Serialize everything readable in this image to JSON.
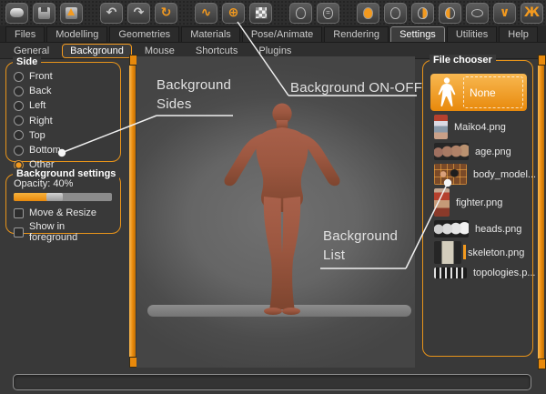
{
  "window": {
    "bg": "#393939"
  },
  "colors": {
    "accent": "#f39a1f",
    "accent_dark": "#e8890b",
    "skin": "#9c5740",
    "viewport_bg": "#656565"
  },
  "toolbar": {
    "items": [
      {
        "name": "new-mesh",
        "icon": "new-document-icon",
        "glyph_type": "shape",
        "shape": "roundrect"
      },
      {
        "name": "save",
        "icon": "floppy-save-icon",
        "glyph_type": "shape",
        "shape": "floppy"
      },
      {
        "name": "load",
        "icon": "floppy-load-icon",
        "glyph_type": "shape",
        "shape": "floppy-up"
      },
      {
        "sep": true
      },
      {
        "name": "undo",
        "icon": "undo-arrow-icon",
        "glyph_type": "char",
        "char": "↶",
        "tone": "gray"
      },
      {
        "name": "redo",
        "icon": "redo-arrow-icon",
        "glyph_type": "char",
        "char": "↷",
        "tone": "gray"
      },
      {
        "name": "reset",
        "icon": "reset-circular-arrow-icon",
        "glyph_type": "char",
        "char": "↻",
        "tone": "orange"
      },
      {
        "sep": true
      },
      {
        "name": "smooth-toggle",
        "icon": "wave-icon",
        "glyph_type": "char",
        "char": "∿",
        "tone": "orange"
      },
      {
        "name": "wireframe-globe",
        "icon": "globe-icon",
        "glyph_type": "char",
        "char": "⊕",
        "tone": "orange"
      },
      {
        "name": "background-toggle",
        "icon": "checkerboard-icon",
        "glyph_type": "shape",
        "shape": "checker"
      },
      {
        "sep": true
      },
      {
        "name": "rotate-view",
        "icon": "head-arrow-icon",
        "glyph_type": "shape",
        "shape": "head"
      },
      {
        "name": "symmetry",
        "icon": "head-equals-icon",
        "glyph_type": "shape",
        "shape": "head-eq"
      },
      {
        "sep": true
      },
      {
        "name": "front-view",
        "icon": "head-front-icon",
        "glyph_type": "shape",
        "shape": "head-front"
      },
      {
        "name": "back-view",
        "icon": "head-outline-icon",
        "glyph_type": "shape",
        "shape": "head"
      },
      {
        "name": "right-view",
        "icon": "head-right-half-icon",
        "glyph_type": "shape",
        "shape": "head-right"
      },
      {
        "name": "left-view",
        "icon": "head-left-half-icon",
        "glyph_type": "shape",
        "shape": "head-left"
      },
      {
        "name": "top-view",
        "icon": "head-top-icon",
        "glyph_type": "shape",
        "shape": "ellipse"
      },
      {
        "name": "bottom-view",
        "icon": "chevron-v-icon",
        "glyph_type": "char",
        "char": "∨",
        "tone": "orange"
      },
      {
        "name": "global-pose",
        "icon": "stick-figure-icon",
        "glyph_type": "char",
        "char": "Ж",
        "tone": "orange"
      },
      {
        "sep": true
      },
      {
        "name": "grab-screenshot",
        "icon": "camera-icon",
        "glyph_type": "shape",
        "shape": "camera"
      },
      {
        "name": "help",
        "icon": "question-mark-icon",
        "glyph_type": "char",
        "char": "?",
        "tone": "orange"
      }
    ]
  },
  "main_tabs": {
    "active": "Settings",
    "items": [
      "Files",
      "Modelling",
      "Geometries",
      "Materials",
      "Pose/Animate",
      "Rendering",
      "Settings",
      "Utilities",
      "Help"
    ]
  },
  "sub_tabs": {
    "active": "Background",
    "items": [
      "General",
      "Background",
      "Mouse",
      "Shortcuts",
      "Plugins"
    ]
  },
  "side_panel": {
    "side_group": {
      "title": "Side",
      "selected": "Other",
      "options": [
        "Front",
        "Back",
        "Left",
        "Right",
        "Top",
        "Bottom",
        "Other"
      ]
    },
    "background_settings": {
      "title": "Background settings",
      "opacity_label": "Opacity: 40%",
      "opacity_percent": 40,
      "checkboxes": [
        {
          "label": "Move & Resize",
          "checked": false
        },
        {
          "label": "Show in foreground",
          "checked": false
        }
      ]
    }
  },
  "file_chooser": {
    "title": "File chooser",
    "selected": "None",
    "items": [
      {
        "label": "None",
        "thumb": "none"
      },
      {
        "label": "Maiko4.png",
        "thumb": "maiko"
      },
      {
        "label": "age.png",
        "thumb": "age"
      },
      {
        "label": "body_model...",
        "thumb": "body"
      },
      {
        "label": "fighter.png",
        "thumb": "fighter"
      },
      {
        "label": "heads.png",
        "thumb": "heads"
      },
      {
        "label": "skeleton.png",
        "thumb": "skeleton"
      },
      {
        "label": "topologies.p...",
        "thumb": "topologies"
      }
    ]
  },
  "annotations": {
    "sides": {
      "text": "Background Sides"
    },
    "onoff": {
      "text": "Background ON-OFF"
    },
    "list": {
      "text": "Background List"
    }
  },
  "status_bar": {
    "text": ""
  }
}
